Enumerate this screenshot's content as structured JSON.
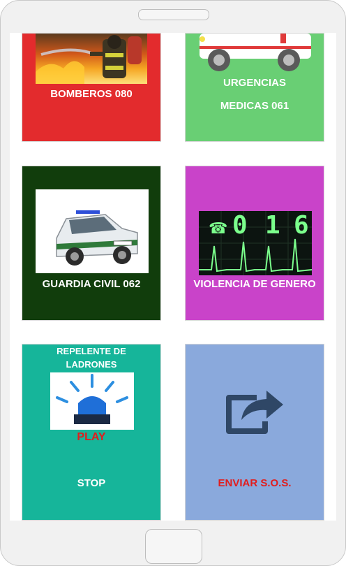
{
  "tiles": {
    "bomberos": {
      "label": "BOMBEROS 080",
      "color": "#e32b2d"
    },
    "urgencias": {
      "label_line1": "URGENCIAS",
      "label_line2": "MEDICAS 061",
      "color": "#69cf74"
    },
    "guardia": {
      "label": "GUARDIA CIVIL 062",
      "color": "#113d0c"
    },
    "violencia": {
      "label": "VIOLENCIA DE GENERO",
      "color": "#c943c9",
      "display_digits": [
        "0",
        "1",
        "6"
      ]
    },
    "repelente": {
      "title_line1": "REPELENTE DE",
      "title_line2": "LADRONES",
      "play_label": "PLAY",
      "stop_label": "STOP",
      "color": "#16b59a"
    },
    "enviar": {
      "label": "ENVIAR S.O.S.",
      "color": "#8aa9dc",
      "label_color": "#e11d1d"
    }
  },
  "icons": {
    "share": "share-icon",
    "siren": "siren-icon",
    "phone": "phone-icon"
  }
}
